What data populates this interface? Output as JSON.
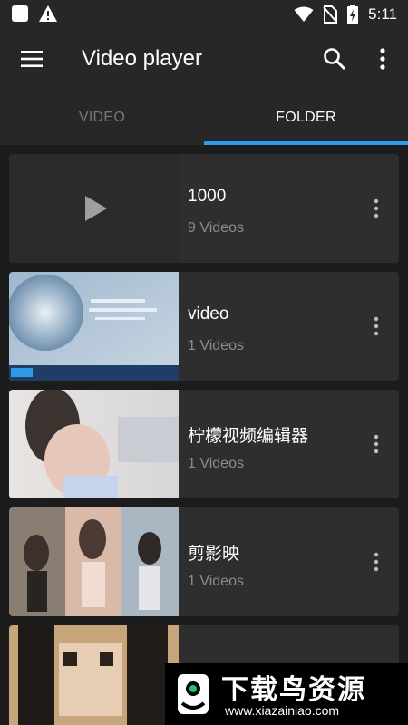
{
  "status_bar": {
    "time": "5:11",
    "icons": [
      "app-square-icon",
      "warning-icon",
      "wifi-icon",
      "no-sim-icon",
      "battery-charging-icon"
    ]
  },
  "app_bar": {
    "title": "Video player",
    "icons": [
      "menu-icon",
      "search-icon",
      "more-vert-icon"
    ]
  },
  "tabs": [
    {
      "label": "VIDEO",
      "selected": false
    },
    {
      "label": "FOLDER",
      "selected": true
    }
  ],
  "colors": {
    "accent": "#2e9be8",
    "background": "#1c1c1c",
    "surface": "#2e2e2e",
    "app_bar": "#272727",
    "secondary_text": "#8c8c8c"
  },
  "folders": [
    {
      "name": "1000",
      "count": "9 Videos",
      "thumbnail": "play-icon"
    },
    {
      "name": "video",
      "count": "1 Videos",
      "thumbnail": "video-frame"
    },
    {
      "name": "柠檬视频编辑器",
      "count": "1 Videos",
      "thumbnail": "video-frame"
    },
    {
      "name": "剪影映",
      "count": "1 Videos",
      "thumbnail": "video-frame"
    },
    {
      "name": "",
      "count": "",
      "thumbnail": "video-frame"
    }
  ],
  "watermark": {
    "title": "下载鸟资源",
    "url": "www.xiazainiao.com"
  }
}
